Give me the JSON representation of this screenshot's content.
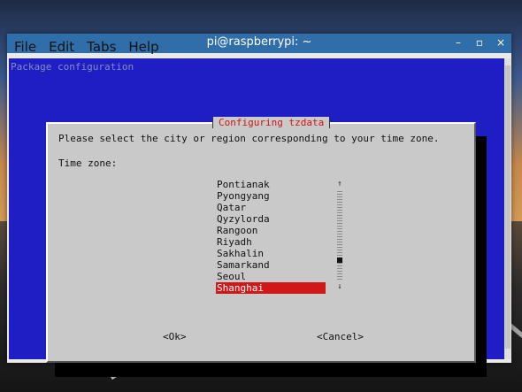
{
  "window": {
    "title": "pi@raspberrypi: ~",
    "buttons": [
      "–",
      "▫",
      "×"
    ]
  },
  "menu": [
    "File",
    "Edit",
    "Tabs",
    "Help"
  ],
  "terminal": {
    "header": "Package configuration"
  },
  "dialog": {
    "title": "Configuring tzdata",
    "prompt": "Please select the city or region corresponding to your time zone.",
    "field_label": "Time zone:",
    "options": [
      "Pontianak",
      "Pyongyang",
      "Qatar",
      "Qyzylorda",
      "Rangoon",
      "Riyadh",
      "Sakhalin",
      "Samarkand",
      "Seoul",
      "Shanghai"
    ],
    "selected": "Shanghai",
    "scroll_position": 0.8,
    "ok_label": "<Ok>",
    "cancel_label": "<Cancel>"
  },
  "colors": {
    "terminal_bg": "#1e1ec4",
    "dialog_bg": "#c9c9c9",
    "highlight": "#d01818",
    "title_red": "#d01515"
  }
}
